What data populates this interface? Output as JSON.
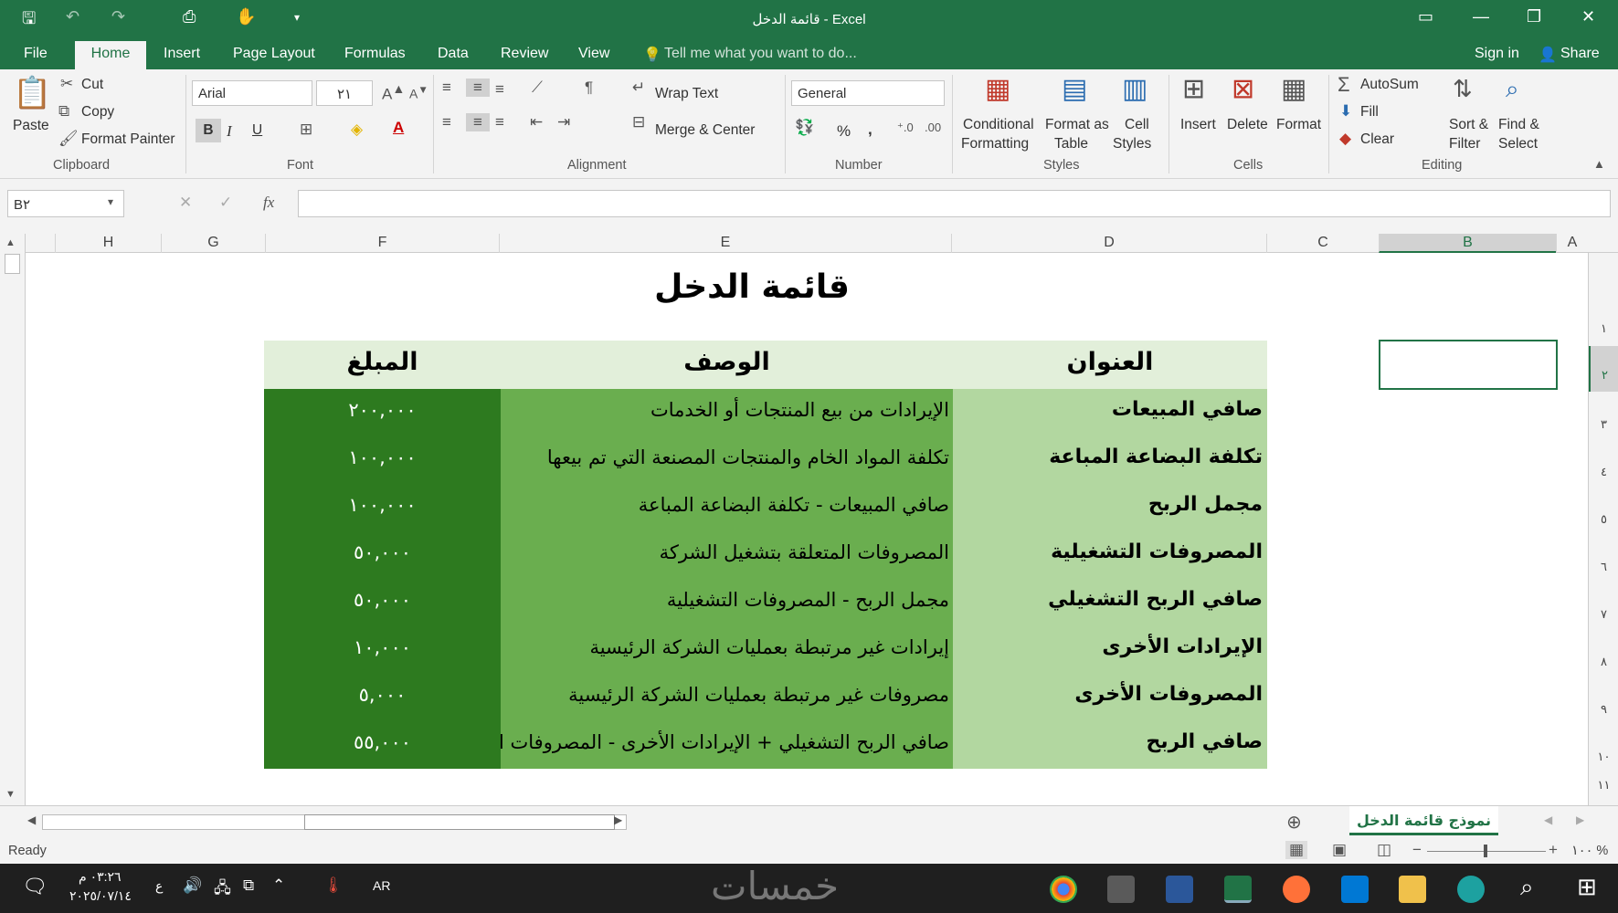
{
  "window": {
    "title": "قائمة الدخل  -  Excel"
  },
  "tabs": [
    {
      "label": "File"
    },
    {
      "label": "Home"
    },
    {
      "label": "Insert"
    },
    {
      "label": "Page Layout"
    },
    {
      "label": "Formulas"
    },
    {
      "label": "Data"
    },
    {
      "label": "Review"
    },
    {
      "label": "View"
    }
  ],
  "tell_me": "Tell me what you want to do...",
  "account": {
    "signin": "Sign in",
    "share": "Share"
  },
  "clipboard": {
    "paste": "Paste",
    "cut": "Cut",
    "copy": "Copy",
    "format_painter": "Format Painter",
    "group": "Clipboard"
  },
  "font": {
    "name": "Arial",
    "size": "٢١",
    "bold": "B",
    "italic": "I",
    "underline": "U",
    "group": "Font"
  },
  "alignment": {
    "wrap_text": "Wrap Text",
    "merge_center": "Merge & Center",
    "group": "Alignment"
  },
  "number": {
    "format": "General",
    "percent": "%",
    "comma": ",",
    "group": "Number"
  },
  "styles": {
    "conditional_1": "Conditional",
    "conditional_2": "Formatting",
    "format_table_1": "Format as",
    "format_table_2": "Table",
    "cell_styles_1": "Cell",
    "cell_styles_2": "Styles",
    "group": "Styles"
  },
  "cells": {
    "insert": "Insert",
    "delete": "Delete",
    "format": "Format",
    "group": "Cells"
  },
  "editing": {
    "autosum": "AutoSum",
    "fill": "Fill",
    "clear": "Clear",
    "sort_1": "Sort &",
    "sort_2": "Filter",
    "find_1": "Find &",
    "find_2": "Select",
    "group": "Editing"
  },
  "formula_bar": {
    "name_box": "B٢",
    "fx": "fx",
    "value": ""
  },
  "columns": [
    "H",
    "G",
    "F",
    "E",
    "D",
    "C",
    "B",
    "A"
  ],
  "rows": [
    "١",
    "٢",
    "٣",
    "٤",
    "٥",
    "٦",
    "٧",
    "٨",
    "٩",
    "١٠",
    "١١"
  ],
  "sheet": {
    "title": "قائمة الدخل",
    "headers": {
      "title": "العنوان",
      "description": "الوصف",
      "amount": "المبلغ"
    },
    "items": [
      {
        "title": "صافي المبيعات",
        "description": "الإيرادات من بيع المنتجات أو الخدمات",
        "amount": "٢٠٠,٠٠٠"
      },
      {
        "title": "تكلفة البضاعة المباعة",
        "description": "تكلفة المواد الخام والمنتجات المصنعة التي تم بيعها",
        "amount": "١٠٠,٠٠٠"
      },
      {
        "title": "مجمل الربح",
        "description": "صافي المبيعات - تكلفة البضاعة المباعة",
        "amount": "١٠٠,٠٠٠"
      },
      {
        "title": "المصروفات التشغيلية",
        "description": "المصروفات المتعلقة بتشغيل الشركة",
        "amount": "٥٠,٠٠٠"
      },
      {
        "title": "صافي الربح التشغيلي",
        "description": "مجمل الربح - المصروفات التشغيلية",
        "amount": "٥٠,٠٠٠"
      },
      {
        "title": "الإيرادات الأخرى",
        "description": "إيرادات غير مرتبطة بعمليات الشركة الرئيسية",
        "amount": "١٠,٠٠٠"
      },
      {
        "title": "المصروفات الأخرى",
        "description": "مصروفات غير مرتبطة بعمليات الشركة الرئيسية",
        "amount": "٥,٠٠٠"
      },
      {
        "title": "صافي الربح",
        "description": "صافي الربح التشغيلي + الإيرادات الأخرى - المصروفات الأخرى",
        "amount": "٥٥,٠٠٠"
      }
    ],
    "tab_name": "نموذج قائمة الدخل"
  },
  "status": {
    "ready": "Ready",
    "zoom": "١٠٠ %"
  },
  "taskbar": {
    "time": "٠٣:٢٦ م",
    "date": "٢٠٢٥/٠٧/١٤",
    "lang": "AR",
    "input": "ع",
    "watermark": "خمسات"
  },
  "colors": {
    "excel_green": "#217346",
    "amount_fill": "#2d7a1f",
    "desc_fill": "#6aae4f",
    "title_fill": "#b2d7a0",
    "header_fill": "#e2efda"
  }
}
